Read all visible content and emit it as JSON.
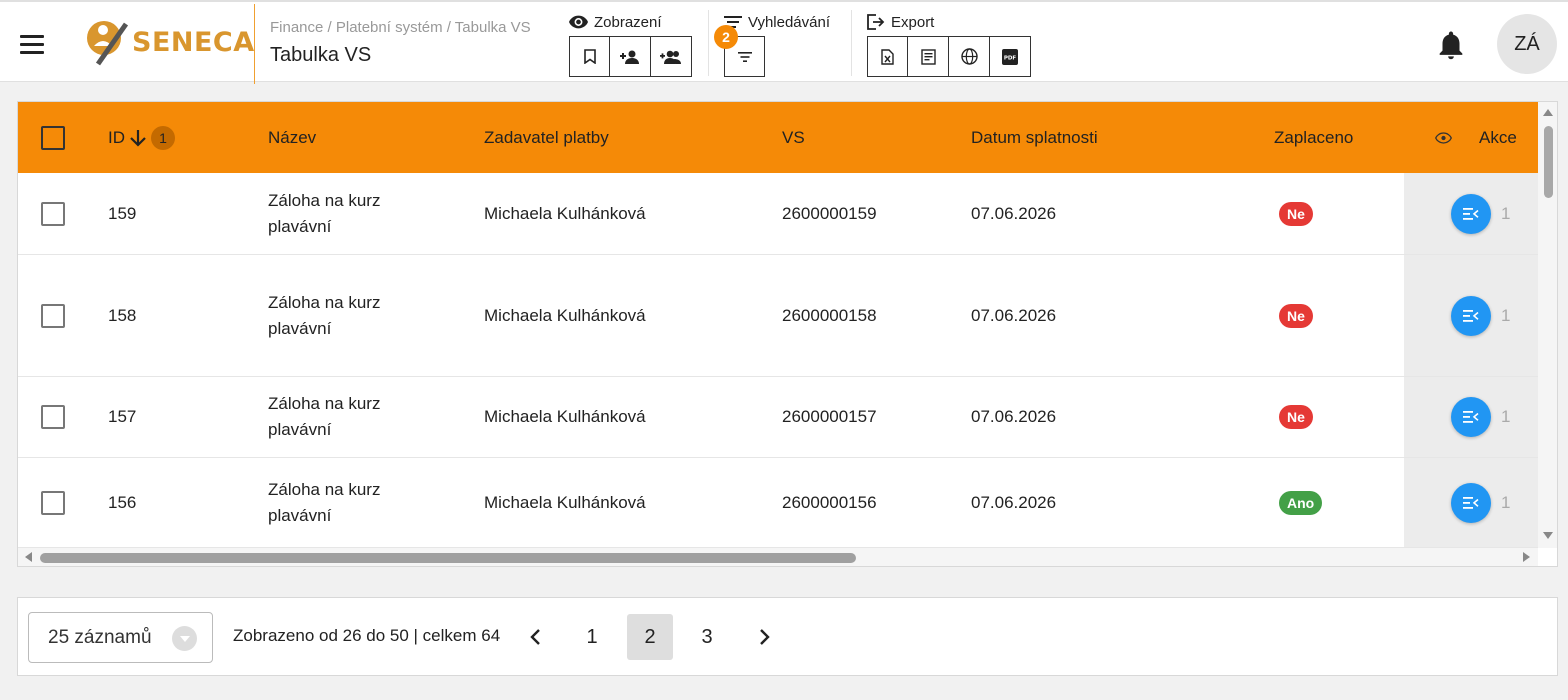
{
  "header": {
    "logo_text": "SENECA",
    "breadcrumb": "Finance / Platební systém / Tabulka VS",
    "title": "Tabulka VS",
    "view_label": "Zobrazení",
    "search_label": "Vyhledávání",
    "search_badge": "2",
    "export_label": "Export",
    "avatar_initials": "ZÁ"
  },
  "table": {
    "columns": {
      "id": "ID",
      "id_sort_badge": "1",
      "name": "Název",
      "payer": "Zadavatel platby",
      "vs": "VS",
      "due_date": "Datum splatnosti",
      "paid": "Zaplaceno",
      "actions": "Akce"
    },
    "rows": [
      {
        "id": "159",
        "name": "Záloha na kurz plavávní",
        "payer": "Michaela Kulhánková",
        "vs": "2600000159",
        "due_date": "07.06.2026",
        "paid": "Ne",
        "action_count": "1"
      },
      {
        "id": "158",
        "name": "Záloha na kurz plavávní",
        "payer": "Michaela Kulhánková",
        "vs": "2600000158",
        "due_date": "07.06.2026",
        "paid": "Ne",
        "action_count": "1"
      },
      {
        "id": "157",
        "name": "Záloha na kurz plavávní",
        "payer": "Michaela Kulhánková",
        "vs": "2600000157",
        "due_date": "07.06.2026",
        "paid": "Ne",
        "action_count": "1"
      },
      {
        "id": "156",
        "name": "Záloha na kurz plavávní",
        "payer": "Michaela Kulhánková",
        "vs": "2600000156",
        "due_date": "07.06.2026",
        "paid": "Ano",
        "action_count": "1"
      }
    ]
  },
  "pagination": {
    "per_page": "25 záznamů",
    "range_text": "Zobrazeno od 26 do 50 | celkem 64",
    "pages": [
      "1",
      "2",
      "3"
    ],
    "current_page": "2"
  },
  "colors": {
    "accent": "#f58a07",
    "logo": "#d9962e",
    "no": "#e53935",
    "yes": "#43a047",
    "action": "#2196f3"
  },
  "icons": [
    "menu-icon",
    "eye-icon",
    "bookmark-icon",
    "person-add-icon",
    "group-add-icon",
    "filter-icon",
    "export-icon",
    "excel-icon",
    "report-icon",
    "globe-icon",
    "pdf-icon",
    "bell-icon",
    "sort-arrow-down-icon",
    "chevron-left-icon",
    "chevron-right-icon",
    "dropdown-arrow-icon"
  ]
}
